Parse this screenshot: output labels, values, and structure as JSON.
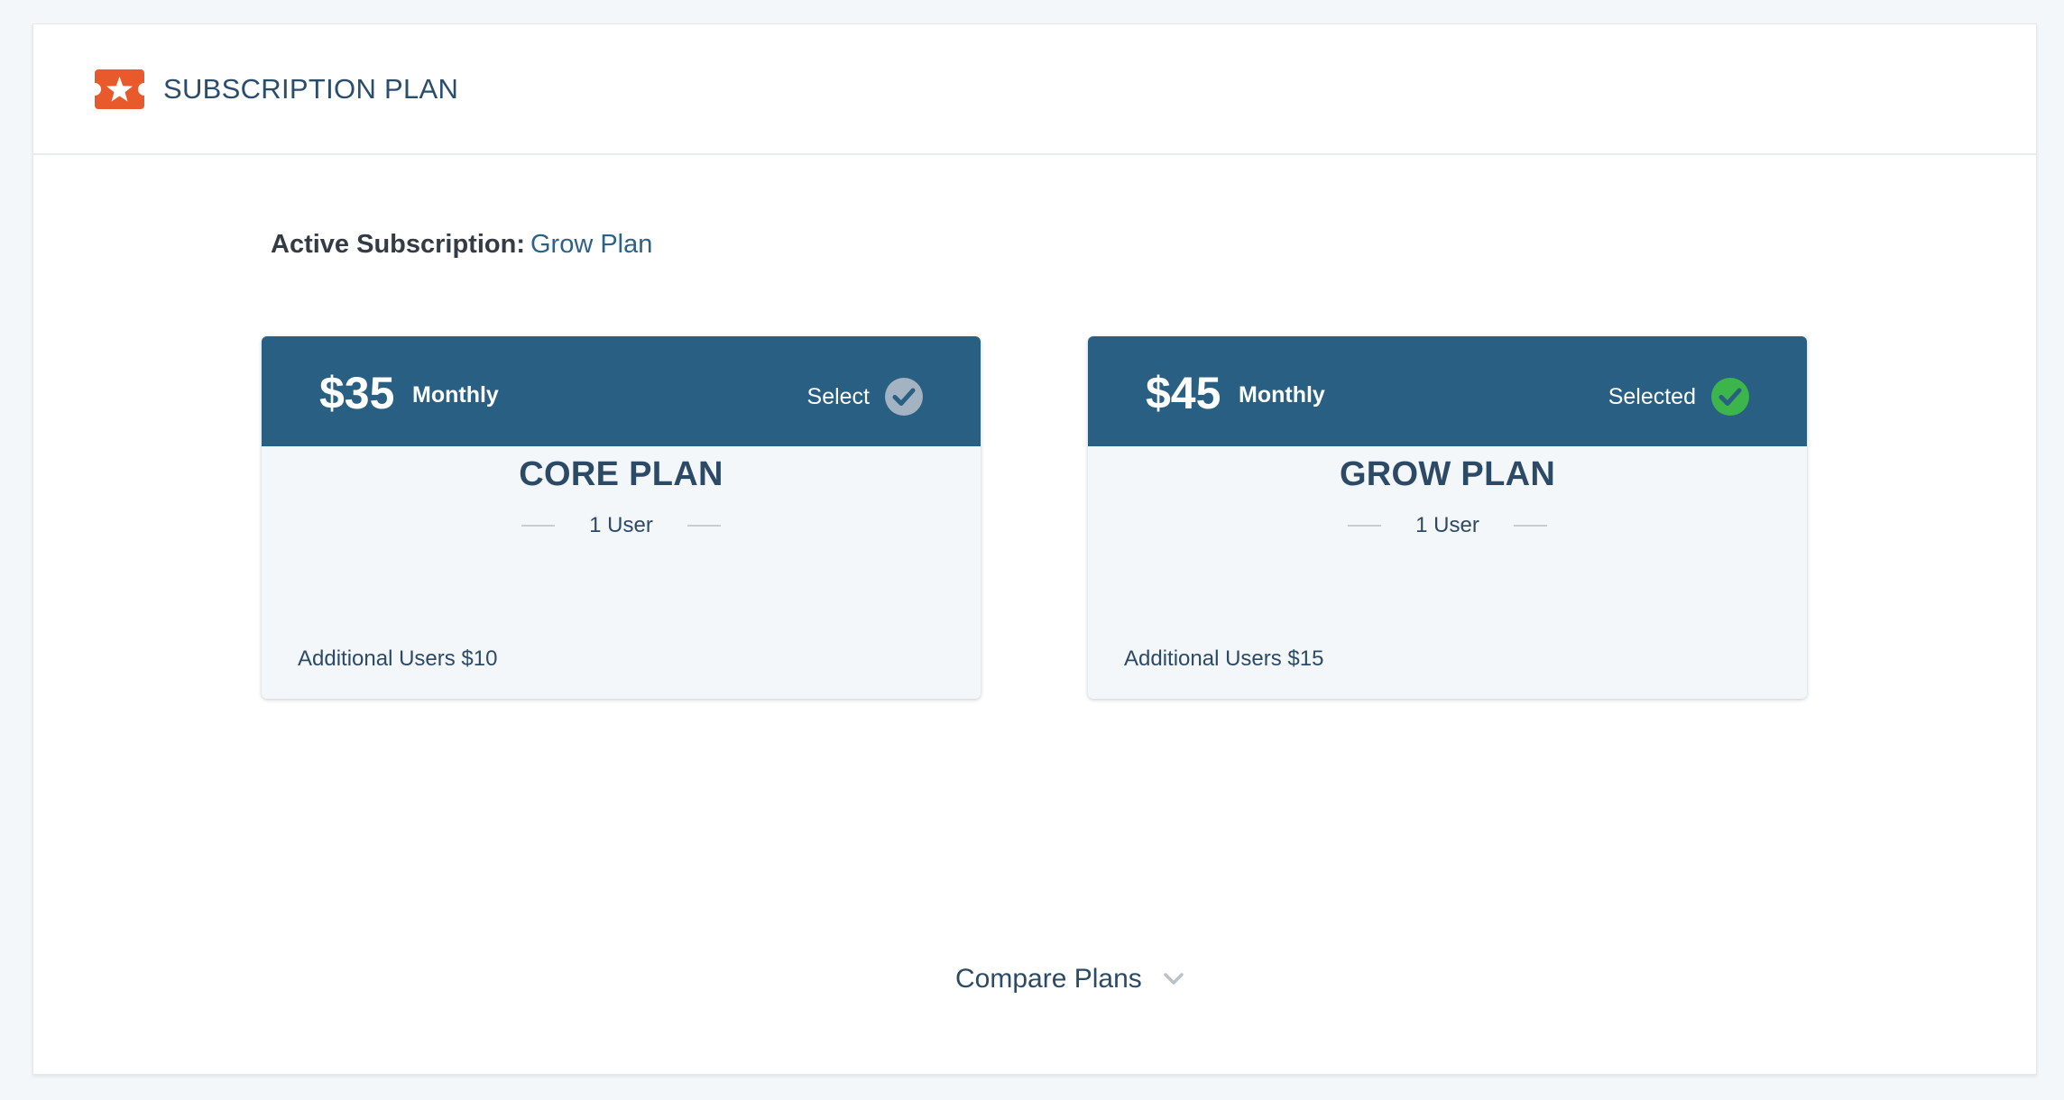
{
  "header": {
    "title": "SUBSCRIPTION PLAN",
    "icon": "ticket-star-icon",
    "icon_color": "#e85a2c"
  },
  "active_subscription": {
    "label": "Active Subscription:",
    "value": "Grow Plan"
  },
  "plans": [
    {
      "price": "$35",
      "period": "Monthly",
      "action_label": "Select",
      "selected": false,
      "check_color": "#a3b3c2",
      "name": "CORE PLAN",
      "users": "1 User",
      "additional": "Additional Users $10"
    },
    {
      "price": "$45",
      "period": "Monthly",
      "action_label": "Selected",
      "selected": true,
      "check_color": "#3cb54a",
      "name": "GROW PLAN",
      "users": "1 User",
      "additional": "Additional Users $15"
    }
  ],
  "compare": {
    "label": "Compare Plans",
    "icon": "chevron-down-icon"
  },
  "colors": {
    "card_header": "#285f82",
    "accent_link": "#2c6287",
    "text": "#2c4a66"
  }
}
